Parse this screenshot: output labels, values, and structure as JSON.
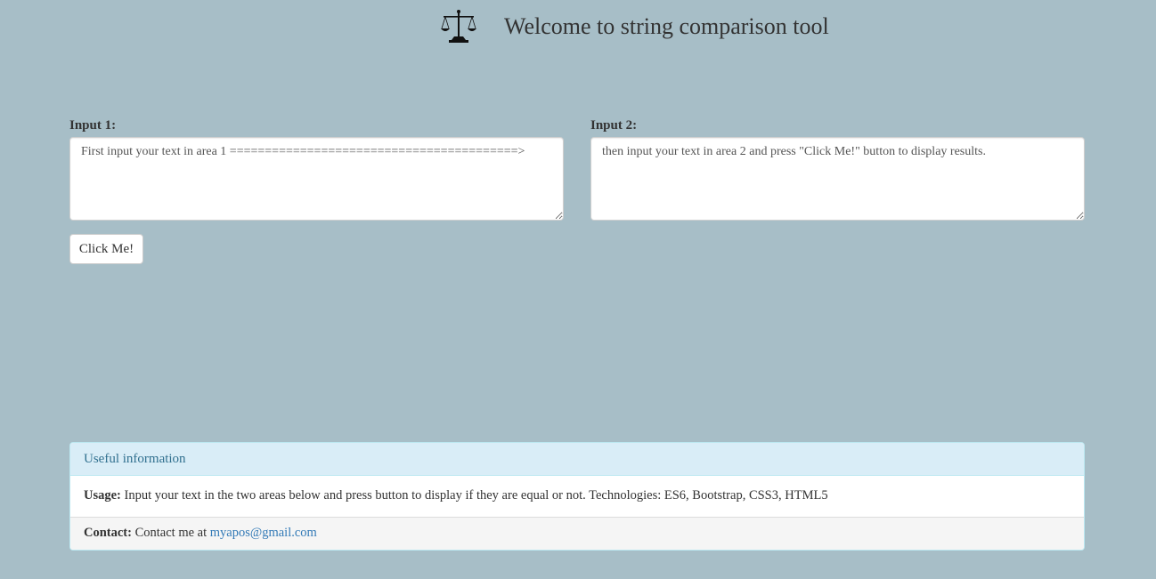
{
  "header": {
    "title": "Welcome to string comparison tool",
    "logo_icon": "scales-of-justice-icon"
  },
  "inputs": {
    "input1": {
      "label": "Input 1:",
      "value": "First input your text in area 1 =========================================>"
    },
    "input2": {
      "label": "Input 2:",
      "value": "then input your text in area 2 and press \"Click Me!\" button to display results."
    }
  },
  "actions": {
    "compare_label": "Click Me!"
  },
  "info": {
    "heading": "Useful information",
    "usage_label": "Usage:",
    "usage_text": "Input your text in the two areas below and press button to display if they are equal or not. Technologies: ES6, Bootstrap, CSS3, HTML5",
    "contact_label": "Contact:",
    "contact_text": "Contact me at",
    "contact_email": "myapos@gmail.com"
  },
  "colors": {
    "background": "#a7bec7",
    "panel_heading_bg": "#d9edf7",
    "panel_heading_text": "#31708f",
    "link": "#337ab7"
  }
}
